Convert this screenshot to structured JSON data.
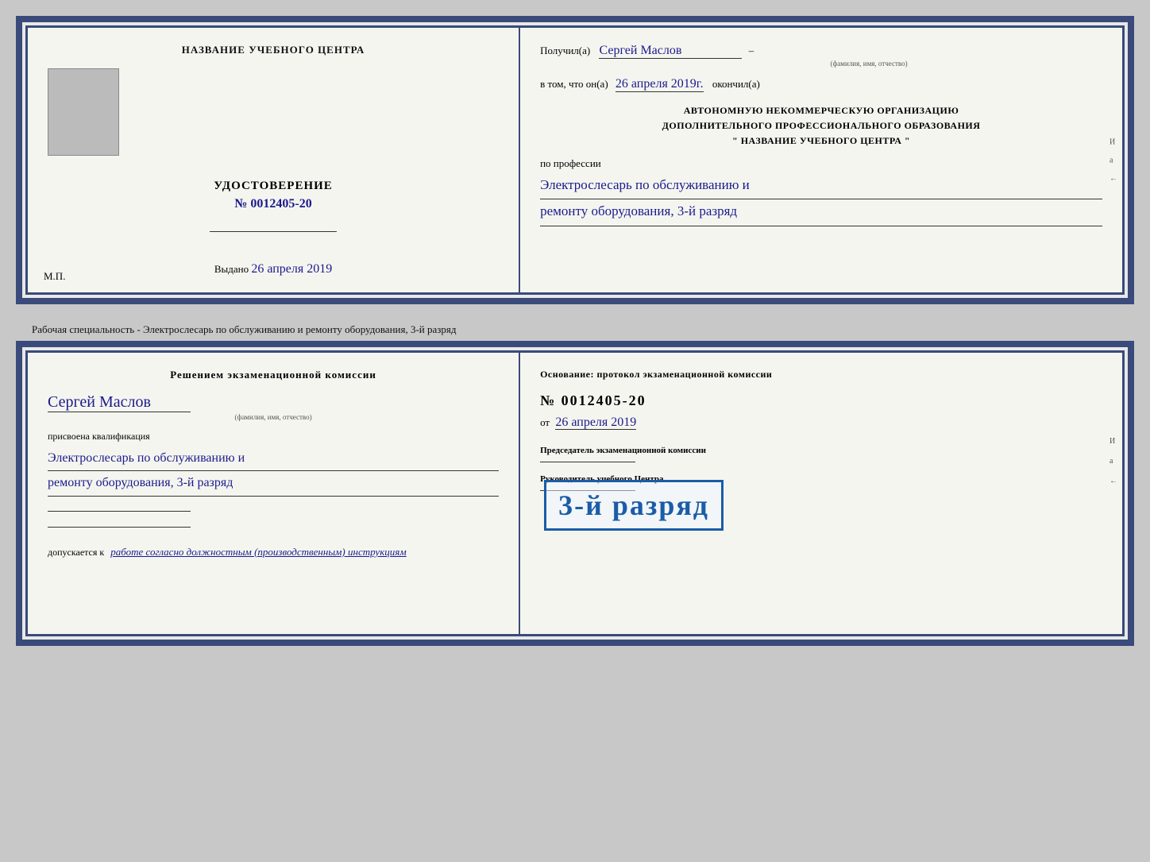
{
  "doc1": {
    "left": {
      "training_center_label": "НАЗВАНИЕ УЧЕБНОГО ЦЕНТРА",
      "udostoverenie": "УДОСТОВЕРЕНИЕ",
      "number": "№ 0012405-20",
      "vydano_label": "Выдано",
      "vydano_date": "26 апреля 2019",
      "mp": "М.П."
    },
    "right": {
      "received_prefix": "Получил(а)",
      "recipient_name": "Сергей Маслов",
      "fio_label": "(фамилия, имя, отчество)",
      "vtom_prefix": "в том, что он(а)",
      "vtom_date": "26 апреля 2019г.",
      "okончил": "окончил(а)",
      "certified_line1": "АВТОНОМНУЮ НЕКОММЕРЧЕСКУЮ ОРГАНИЗАЦИЮ",
      "certified_line2": "ДОПОЛНИТЕЛЬНОГО ПРОФЕССИОНАЛЬНОГО ОБРАЗОВАНИЯ",
      "certified_line3": "\"    НАЗВАНИЕ УЧЕБНОГО ЦЕНТРА    \"",
      "po_professii": "по профессии",
      "profession_line1": "Электрослесарь по обслуживанию и",
      "profession_line2": "ремонту оборудования, 3-й разряд",
      "side1": "И",
      "side2": "а",
      "side3": "←"
    }
  },
  "separator": {
    "text": "Рабочая специальность - Электрослесарь по обслуживанию и ремонту оборудования, 3-й разряд"
  },
  "doc2": {
    "left": {
      "decision_title": "Решением экзаменационной комиссии",
      "name": "Сергей Маслов",
      "fio_label": "(фамилия, имя, отчество)",
      "prisvoena": "присвоена квалификация",
      "qual_line1": "Электрослесарь по обслуживанию и",
      "qual_line2": "ремонту оборудования, 3-й разряд",
      "dopuskaetsya": "допускается к",
      "admit_text": "работе согласно должностным (производственным) инструкциям"
    },
    "right": {
      "osnov_label": "Основание: протокол экзаменационной комиссии",
      "number": "№  0012405-20",
      "ot_label": "от",
      "ot_date": "26 апреля 2019",
      "stamp_text": "3-й разряд",
      "chairman_label": "Председатель экзаменационной комиссии",
      "head_label": "Руководитель учебного Центра",
      "side1": "И",
      "side2": "а",
      "side3": "←"
    }
  }
}
